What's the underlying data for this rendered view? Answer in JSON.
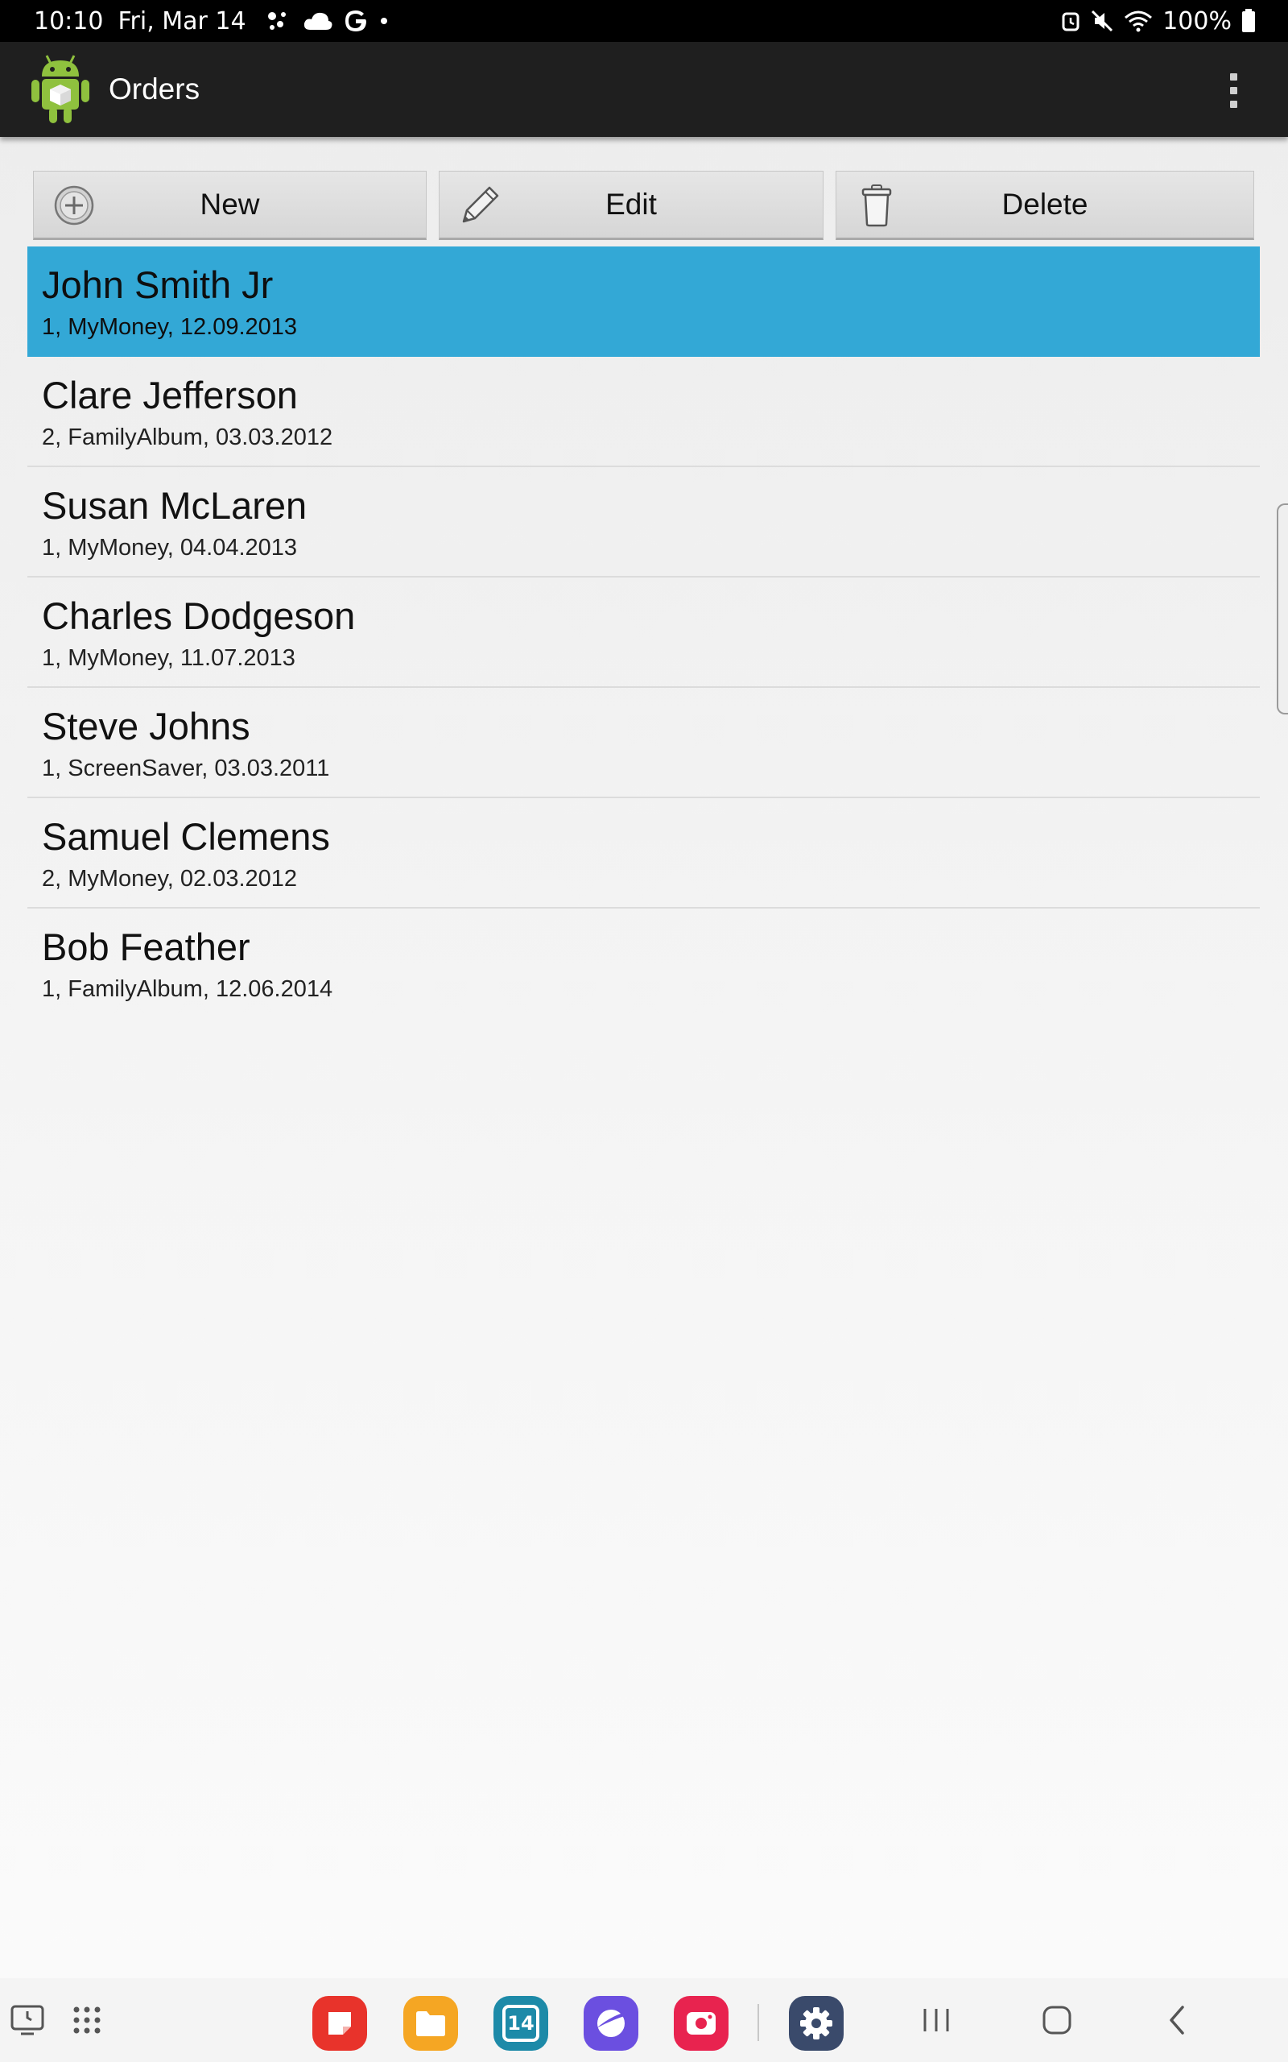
{
  "status_bar": {
    "time": "10:10",
    "date": "Fri, Mar 14",
    "battery": "100%"
  },
  "action_bar": {
    "title": "Orders",
    "logo_icon": "android-robot-icon",
    "overflow_icon": "more-vert-icon"
  },
  "toolbar": {
    "new_label": "New",
    "edit_label": "Edit",
    "delete_label": "Delete"
  },
  "orders": [
    {
      "name": "John Smith Jr",
      "detail": "1, MyMoney, 12.09.2013",
      "selected": true
    },
    {
      "name": "Clare Jefferson",
      "detail": "2, FamilyAlbum, 03.03.2012"
    },
    {
      "name": "Susan McLaren",
      "detail": "1, MyMoney, 04.04.2013"
    },
    {
      "name": "Charles Dodgeson",
      "detail": "1, MyMoney, 11.07.2013"
    },
    {
      "name": "Steve Johns",
      "detail": "1, ScreenSaver, 03.03.2011"
    },
    {
      "name": "Samuel Clemens",
      "detail": "2, MyMoney, 02.03.2012"
    },
    {
      "name": "Bob Feather",
      "detail": "1, FamilyAlbum, 12.06.2014"
    }
  ],
  "taskbar": {
    "calendar_day": "14",
    "selected_color": "#33a8d6"
  }
}
